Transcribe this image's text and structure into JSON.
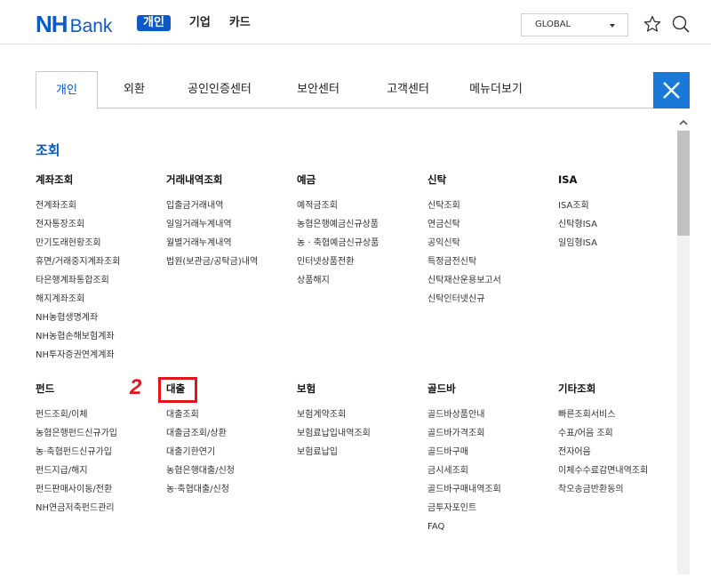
{
  "header": {
    "logo_nh": "NH",
    "logo_bank": "Bank",
    "nav": [
      "개인",
      "기업",
      "카드"
    ],
    "global_label": "GLOBAL",
    "icons": [
      "star-icon",
      "search-icon"
    ]
  },
  "tabs": [
    "개인",
    "외환",
    "공인인증센터",
    "보안센터",
    "고객센터",
    "메뉴더보기"
  ],
  "close_icon": "close-icon",
  "section_title": "조회",
  "columns": [
    {
      "head": "계좌조회",
      "items": [
        "전계좌조회",
        "전자통장조회",
        "만기도래현황조회",
        "휴면/거래중지계좌조회",
        "타은행계좌통합조회",
        "해지계좌조회",
        "NH농협생명계좌",
        "NH농협손해보험계좌",
        "NH투자증권연계계좌"
      ]
    },
    {
      "head": "거래내역조회",
      "items": [
        "입출금거래내역",
        "일일거래누계내역",
        "월별거래누계내역",
        "법원(보관금/공탁금)내역"
      ]
    },
    {
      "head": "예금",
      "items": [
        "예적금조회",
        "농협은행예금신규상품",
        "농 · 축협예금신규상품",
        "인터넷상품전환",
        "상품해지"
      ]
    },
    {
      "head": "신탁",
      "items": [
        "신탁조회",
        "연금신탁",
        "공익신탁",
        "특정금전신탁",
        "신탁재산운용보고서",
        "신탁인터넷신규"
      ]
    },
    {
      "head": "ISA",
      "items": [
        "ISA조회",
        "신탁형ISA",
        "일임형ISA"
      ]
    },
    {
      "head": "펀드",
      "items": [
        "펀드조회/이체",
        "농협은행펀드신규가입",
        "농·축협펀드신규가입",
        "펀드지급/해지",
        "펀드판매사이동/전환",
        "NH연금저축펀드관리"
      ]
    },
    {
      "head": "대출",
      "items": [
        "대출조회",
        "대출금조회/상환",
        "대출기한연기",
        "농협은행대출/신청",
        "농·축협대출/신청"
      ]
    },
    {
      "head": "보험",
      "items": [
        "보험계약조회",
        "보험료납입내역조회",
        "보험료납입"
      ]
    },
    {
      "head": "골드바",
      "items": [
        "골드바상품안내",
        "골드바가격조회",
        "골드바구매",
        "금시세조회",
        "골드바구매내역조회",
        "금투자포인트",
        "FAQ"
      ]
    },
    {
      "head": "기타조회",
      "items": [
        "빠른조회서비스",
        "수표/어음 조회",
        "전자어음",
        "이체수수료감면내역조회",
        "착오송금반환동의"
      ]
    }
  ],
  "annotation": {
    "number": "2"
  },
  "colors": {
    "brand": "#0a5ac8",
    "close_bg": "#1a78d6",
    "annotation": "#e0161b"
  }
}
